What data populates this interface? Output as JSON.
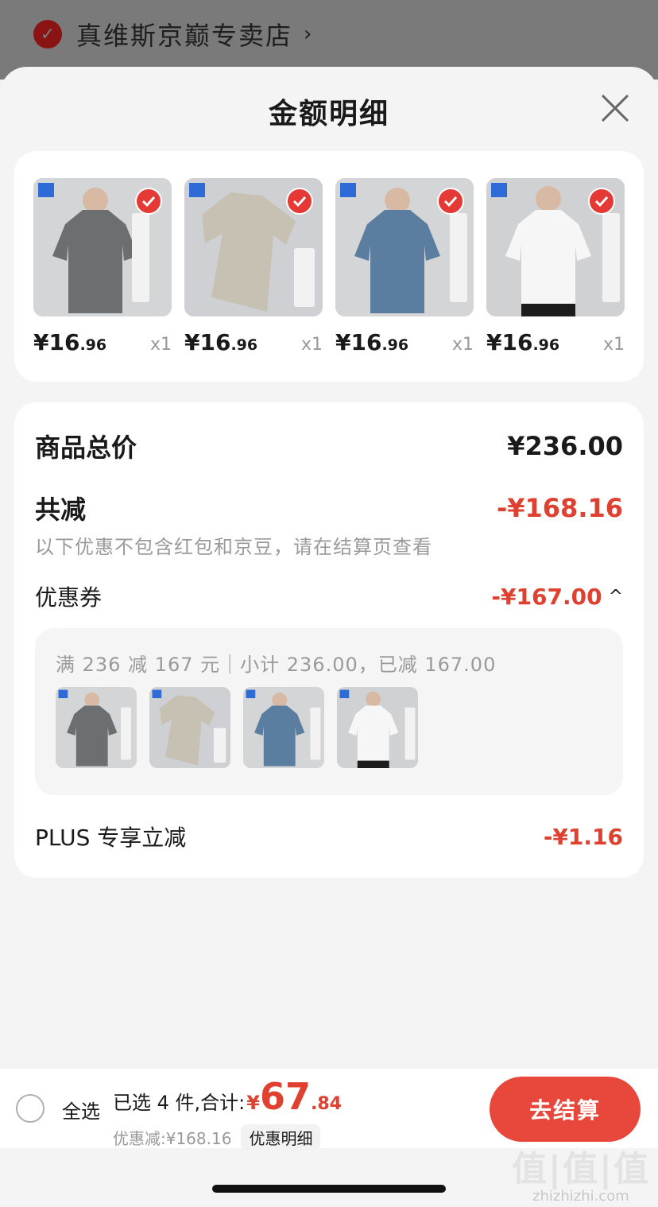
{
  "background": {
    "store_name": "真维斯京巅专卖店",
    "chevron": "›"
  },
  "sheet": {
    "title": "金额明细",
    "close_icon": "close-icon"
  },
  "products": [
    {
      "price_main": "¥16",
      "price_dec": ".96",
      "qty": "x1",
      "color": "#6b6f72"
    },
    {
      "price_main": "¥16",
      "price_dec": ".96",
      "qty": "x1",
      "color": "#c7c1b4"
    },
    {
      "price_main": "¥16",
      "price_dec": ".96",
      "qty": "x1",
      "color": "#5b7d9f"
    },
    {
      "price_main": "¥16",
      "price_dec": ".96",
      "qty": "x1",
      "color": "#f4f4f4"
    }
  ],
  "summary": {
    "total_label": "商品总价",
    "total_value": "¥236.00",
    "reduce_label": "共减",
    "reduce_value": "-¥168.16",
    "hint": "以下优惠不包含红包和京豆，请在结算页查看",
    "coupon_label": "优惠券",
    "coupon_value": "-¥167.00",
    "coupon_chevron": "^",
    "coupon_desc": "满 236 减 167 元｜小计 236.00，已减 167.00",
    "plus_label": "PLUS 专享立减",
    "plus_value": "-¥1.16"
  },
  "bottom_bar": {
    "select_all": "全选",
    "selected_text": "已选 4 件,合计:",
    "currency": "¥",
    "total_int": "67",
    "total_dec": ".84",
    "discount_text": "优惠减:¥168.16",
    "detail_button": "优惠明细",
    "checkout_button": "去结算"
  },
  "watermark": {
    "big": "值|值|值",
    "small": "zhizhizhi.com"
  },
  "colors": {
    "accent_red": "#e0402f",
    "checkout_red": "#e8473b"
  }
}
